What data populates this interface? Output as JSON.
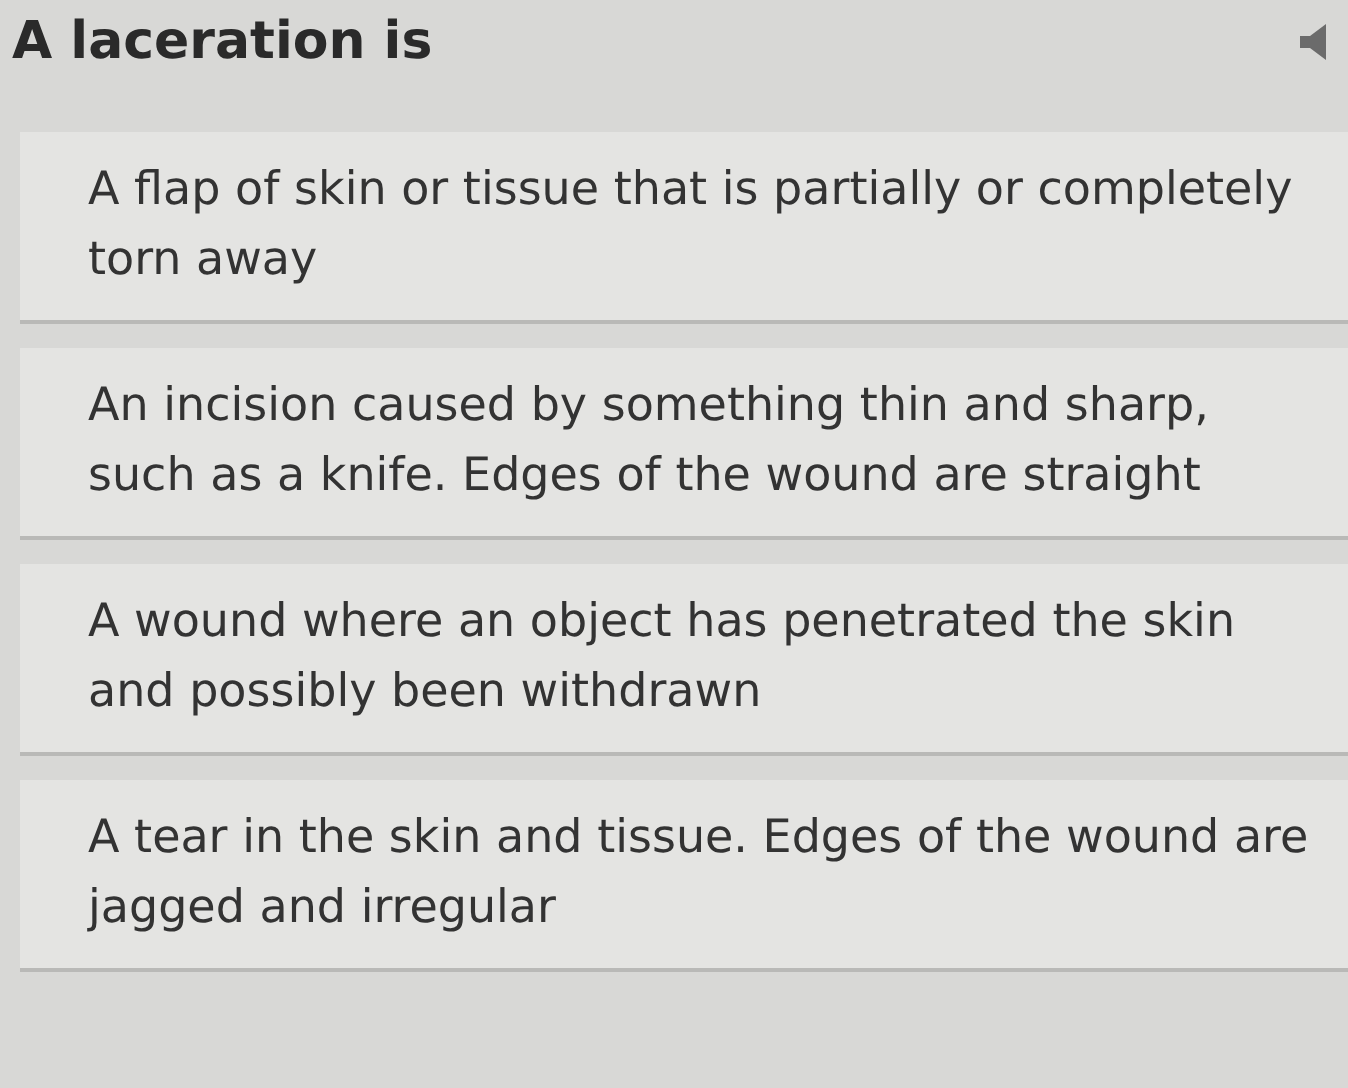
{
  "question": "A laceration is",
  "choices": [
    {
      "text": "A flap of skin or tissue that is partially or completely torn away"
    },
    {
      "text": "An incision caused by something thin and sharp, such as a knife.  Edges of the wound are straight"
    },
    {
      "text": "A wound where an object has penetrated the skin and possibly been withdrawn"
    },
    {
      "text": "A tear in the skin and tissue.  Edges of the wound are jagged and irregular"
    }
  ]
}
